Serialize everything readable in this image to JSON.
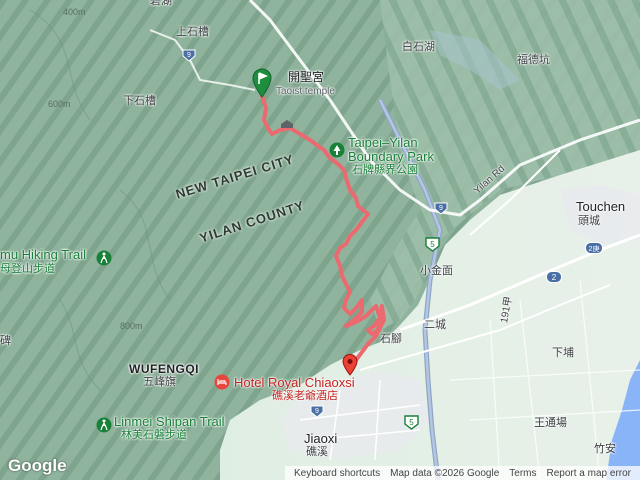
{
  "map": {
    "type": "terrain",
    "start_marker_label": "開聖宮",
    "start_marker_sublabel": "Taoist temple",
    "route_color": "#ea6a6f",
    "start_marker_color": "#1e8e3e",
    "end_marker_color": "#ea4335"
  },
  "labels": {
    "new_taipei": "NEW TAIPEI CITY",
    "yilan_county": "YILAN COUNTY",
    "wufengqi_en": "WUFENGQI",
    "wufengqi_zh": "五峰旗",
    "jiaoxi_en": "Jiaoxi",
    "jiaoxi_zh": "礁溪",
    "toucheng_en": "Touchen",
    "toucheng_zh": "頭城",
    "park_en_1": "Taipei–Yilan",
    "park_en_2": "Boundary Park",
    "park_zh": "石牌縣界公園",
    "hotel_en": "Hotel Royal Chiaoxsi",
    "hotel_zh": "礁溪老爺酒店",
    "linmei_en": "Linmei Shipan Trail",
    "linmei_zh": "林美石磐步道",
    "mu_trail_en": "mu Hiking Trail",
    "mu_trail_zh": "母登山步道",
    "top_left": "上石槽",
    "mid_left": "下石槽",
    "baishihu": "白石湖",
    "fudekeng": "福德坑",
    "xiaojinmian": "小金面",
    "ercheng": "二城",
    "shijiao": "石腳",
    "xiapu": "下埔",
    "wangtongchang": "王通場",
    "zhuan": "竹安",
    "yilan_rd": "Yilan Rd",
    "road_191": "191甲",
    "top_cut": "碧湖",
    "edge_char": "碑",
    "elev_400": "400m",
    "elev_600": "600m",
    "elev_800": "800m",
    "route_9": "9",
    "route_5": "5",
    "route_2": "2",
    "route_2b": "2庚"
  },
  "footer": {
    "google": "Google",
    "keyboard": "Keyboard shortcuts",
    "map_data": "Map data ©2026 Google",
    "terms": "Terms",
    "report": "Report a map error"
  }
}
